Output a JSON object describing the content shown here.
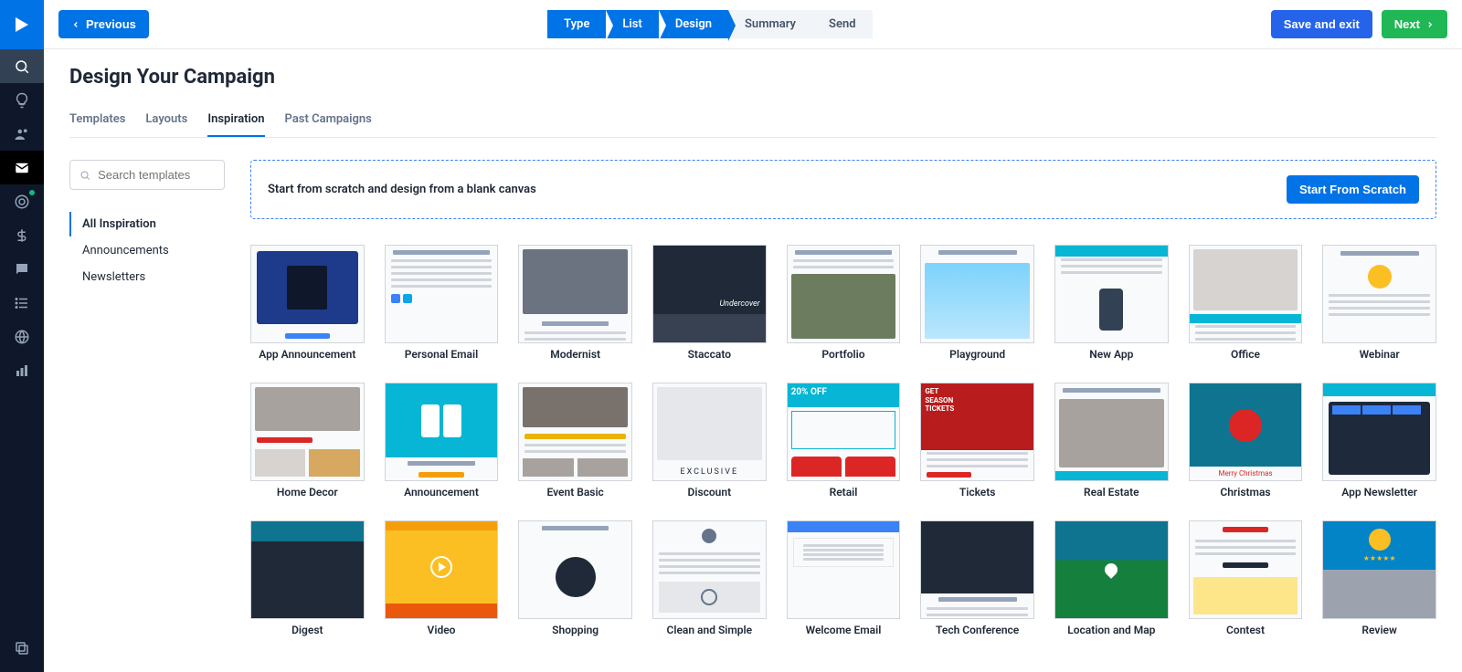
{
  "header": {
    "previous": "Previous",
    "save_exit": "Save and exit",
    "next": "Next"
  },
  "steps": [
    {
      "label": "Type",
      "active": true
    },
    {
      "label": "List",
      "active": true
    },
    {
      "label": "Design",
      "active": true
    },
    {
      "label": "Summary",
      "active": false
    },
    {
      "label": "Send",
      "active": false
    }
  ],
  "page": {
    "title": "Design Your Campaign"
  },
  "tabs": [
    "Templates",
    "Layouts",
    "Inspiration",
    "Past Campaigns"
  ],
  "tab_active": "Inspiration",
  "search": {
    "placeholder": "Search templates"
  },
  "categories": [
    "All Inspiration",
    "Announcements",
    "Newsletters"
  ],
  "category_active": "All Inspiration",
  "scratch": {
    "text": "Start from scratch and design from a blank canvas",
    "button": "Start From Scratch"
  },
  "templates": [
    {
      "name": "App Announcement",
      "variant": "app-ann"
    },
    {
      "name": "Personal Email",
      "variant": "personal"
    },
    {
      "name": "Modernist",
      "variant": "modernist"
    },
    {
      "name": "Staccato",
      "variant": "staccato"
    },
    {
      "name": "Portfolio",
      "variant": "portfolio"
    },
    {
      "name": "Playground",
      "variant": "playground"
    },
    {
      "name": "New App",
      "variant": "newapp"
    },
    {
      "name": "Office",
      "variant": "office"
    },
    {
      "name": "Webinar",
      "variant": "webinar"
    },
    {
      "name": "Home Decor",
      "variant": "homedecor"
    },
    {
      "name": "Announcement",
      "variant": "announcement"
    },
    {
      "name": "Event Basic",
      "variant": "event"
    },
    {
      "name": "Discount",
      "variant": "discount"
    },
    {
      "name": "Retail",
      "variant": "retail"
    },
    {
      "name": "Tickets",
      "variant": "tickets"
    },
    {
      "name": "Real Estate",
      "variant": "realestate"
    },
    {
      "name": "Christmas",
      "variant": "christmas"
    },
    {
      "name": "App Newsletter",
      "variant": "appnews"
    },
    {
      "name": "Digest",
      "variant": "digest"
    },
    {
      "name": "Video",
      "variant": "video"
    },
    {
      "name": "Shopping",
      "variant": "shopping"
    },
    {
      "name": "Clean and Simple",
      "variant": "clean"
    },
    {
      "name": "Welcome Email",
      "variant": "welcome"
    },
    {
      "name": "Tech Conference",
      "variant": "tech"
    },
    {
      "name": "Location and Map",
      "variant": "map"
    },
    {
      "name": "Contest",
      "variant": "contest"
    },
    {
      "name": "Review",
      "variant": "review"
    }
  ],
  "sidebar_icons": [
    "search-icon",
    "idea-icon",
    "contacts-icon",
    "mail-icon",
    "deal-icon",
    "money-icon",
    "chat-icon",
    "list-icon",
    "globe-icon",
    "bar-chart-icon"
  ]
}
